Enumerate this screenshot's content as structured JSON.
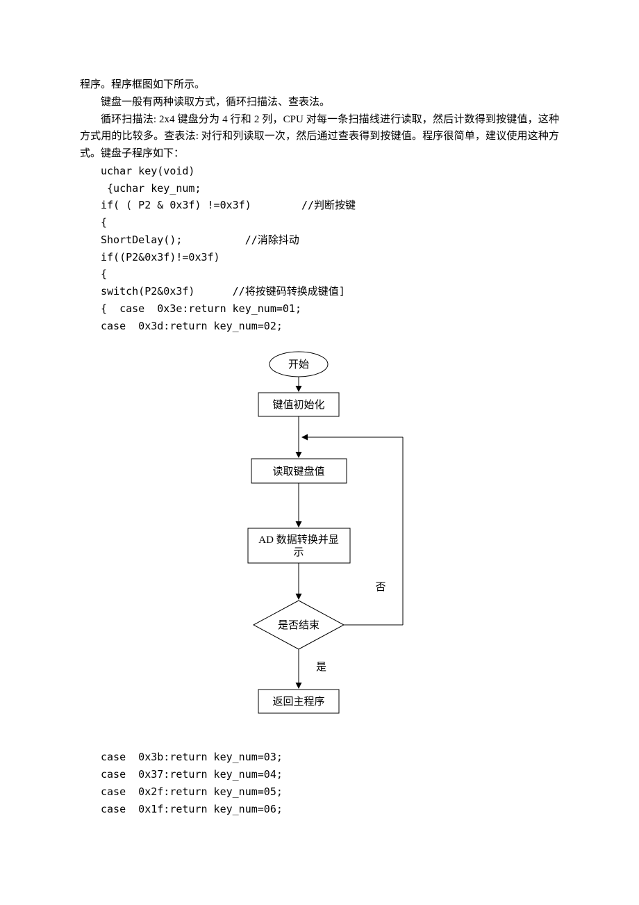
{
  "paragraphs": {
    "p1": "程序。程序框图如下所示。",
    "p2": "键盘一般有两种读取方式，循环扫描法、查表法。",
    "p3": "循环扫描法: 2x4 键盘分为 4 行和 2 列，CPU 对每一条扫描线进行读取，然后计数得到按键值，这种方式用的比较多。查表法: 对行和列读取一次，然后通过查表得到按键值。程序很简单，建议使用这种方式。键盘子程序如下："
  },
  "code_top": {
    "l1": "uchar key(void)",
    "l2": " {uchar key_num;",
    "l3": "if( ( P2 & 0x3f) !=0x3f)        //判断按键",
    "l4": "{",
    "l5": "ShortDelay();          //消除抖动",
    "l6": "if((P2&0x3f)!=0x3f)",
    "l7": "{",
    "l8": "switch(P2&0x3f)      //将按键码转换成键值]",
    "l9": "{  case  0x3e:return key_num=01;",
    "l10": "case  0x3d:return key_num=02;"
  },
  "flow": {
    "start": "开始",
    "init": "键值初始化",
    "read": "读取键盘值",
    "ad": "AD 数据转换并显示",
    "decision": "是否结束",
    "no": "否",
    "yes": "是",
    "return": "返回主程序"
  },
  "code_bottom": {
    "l1": "case  0x3b:return key_num=03;",
    "l2": "case  0x37:return key_num=04;",
    "l3": "case  0x2f:return key_num=05;",
    "l4": "case  0x1f:return key_num=06;"
  }
}
